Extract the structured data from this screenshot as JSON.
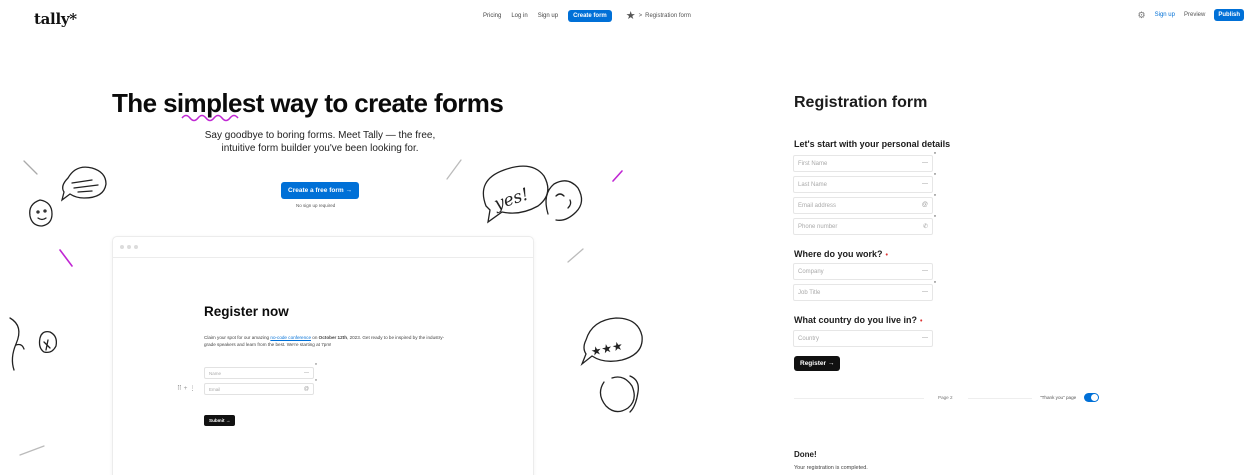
{
  "header": {
    "logo": "tally*",
    "nav": {
      "pricing": "Pricing",
      "login": "Log in",
      "signup": "Sign up",
      "create": "Create form"
    },
    "breadcrumb": {
      "separator": ">",
      "title": "Registration form"
    },
    "right": {
      "signup": "Sign up",
      "preview": "Preview",
      "publish": "Publish"
    }
  },
  "hero": {
    "title_before": "The ",
    "title_highlight": "simplest",
    "title_after": " way to create forms",
    "subtitle_line1": "Say goodbye to boring forms. Meet Tally — the free,",
    "subtitle_line2": "intuitive form builder you've been looking for.",
    "cta": "Create a free form →",
    "note": "No sign up required",
    "doodle_text": "yes!"
  },
  "preview": {
    "title": "Register now",
    "text_before": "Claim your spot for our amazing ",
    "text_link": "no-code conference",
    "text_mid": " on ",
    "text_date": "October 12th",
    "text_after": ", 2023. Get ready to be inspired by the industry-grade speakers and learn from the best. We're starting at 7pm!",
    "field_name": "Name",
    "field_email": "Email",
    "handle": "⠿ + ⋮",
    "submit": "Submit →"
  },
  "form": {
    "title": "Registration form",
    "section1": "Let's start with your personal details",
    "first_name": "First Name",
    "last_name": "Last Name",
    "email": "Email address",
    "phone": "Phone number",
    "section2": "Where do you work?",
    "company": "Company",
    "job_title": "Job Title",
    "section3": "What country do you live in?",
    "country": "Country",
    "register": "Register →",
    "page_label": "Page 2",
    "thanks_label": "\"Thank you\" page",
    "done_title": "Done!",
    "done_text": "Your registration is completed."
  },
  "colors": {
    "accent": "#0070d7",
    "highlight": "#c026d3",
    "text": "#111111"
  }
}
